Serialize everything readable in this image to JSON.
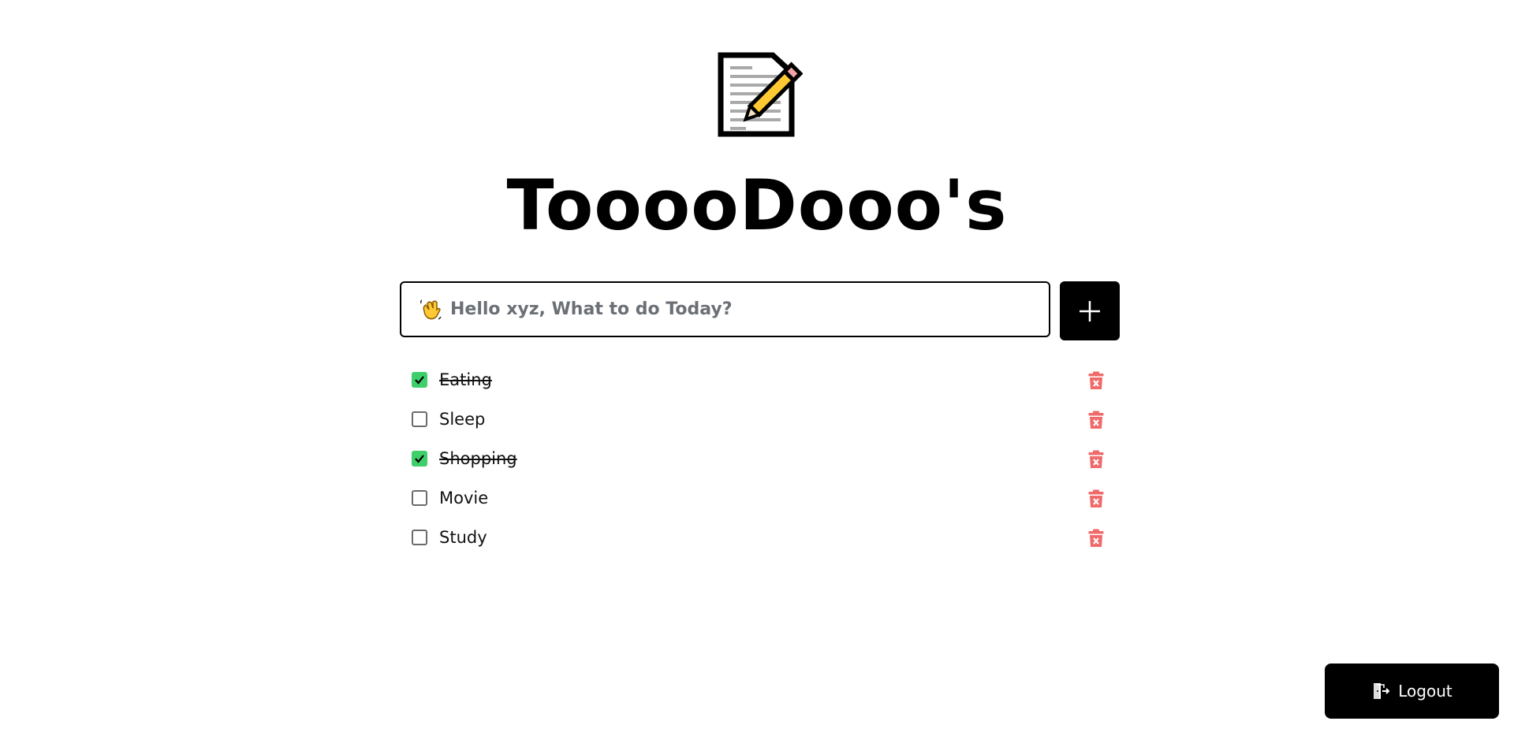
{
  "app": {
    "title": "TooooDooo's",
    "logo_icon": "memo-pencil-icon"
  },
  "new_task": {
    "placeholder": "Hello xyz, What to do Today?",
    "value": "",
    "prefix_icon": "waving-hand-icon",
    "add_button_icon": "plus-icon"
  },
  "todos": [
    {
      "text": "Eating",
      "done": true
    },
    {
      "text": "Sleep",
      "done": false
    },
    {
      "text": "Shopping",
      "done": true
    },
    {
      "text": "Movie",
      "done": false
    },
    {
      "text": "Study",
      "done": false
    }
  ],
  "colors": {
    "checked": "#3ecf6a",
    "delete": "#f06a6a",
    "primary": "#000000"
  },
  "logout": {
    "label": "Logout",
    "icon": "door-exit-icon"
  }
}
